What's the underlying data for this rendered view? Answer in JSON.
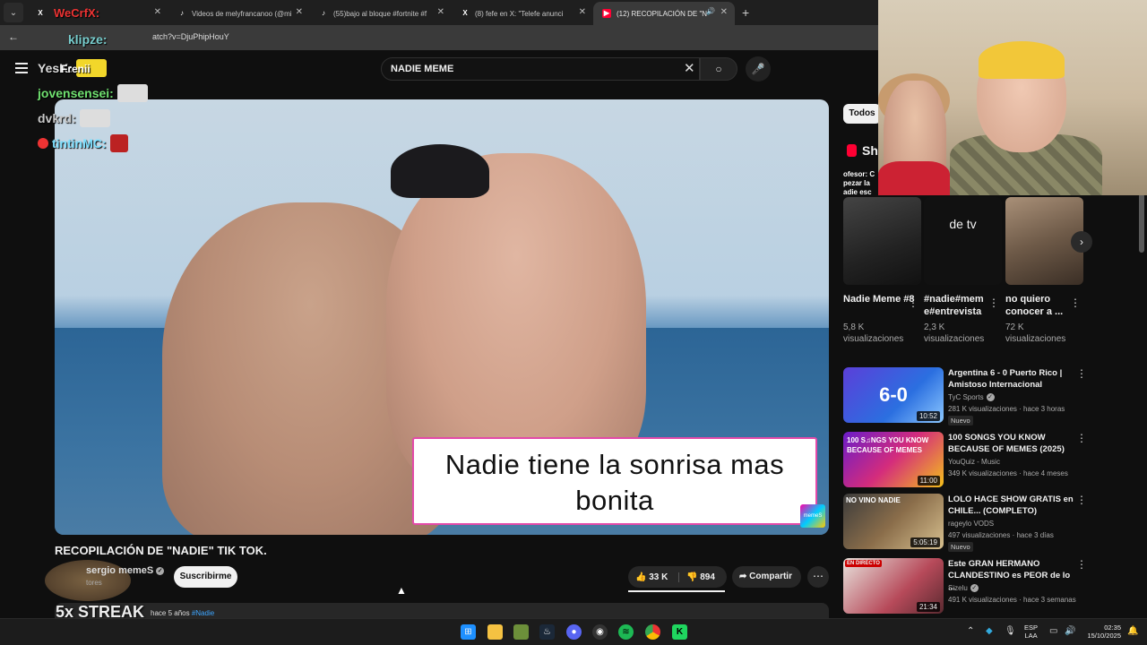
{
  "browser": {
    "tabs": [
      {
        "label": "",
        "icon": "x-logo-icon",
        "active": false
      },
      {
        "label": "Videos de melyfrancanoo (@mi",
        "icon": "tiktok-icon",
        "active": false
      },
      {
        "label": "(55)bajo al bloque #fortnite #f",
        "icon": "tiktok-icon",
        "active": false
      },
      {
        "label": "(8) fefe en X: \"Telefe anunci",
        "icon": "x-logo-icon",
        "active": false
      },
      {
        "label": "(12) RECOPILACIÓN DE \"N",
        "icon": "youtube-icon",
        "active": true
      }
    ],
    "url_partial": "atch?v=DjuPhipHouY"
  },
  "search": {
    "value": "NADIE MEME"
  },
  "video": {
    "caption": "Nadie tiene la sonrisa mas bonita",
    "title": "RECOPILACIÓN DE \"NADIE\" TIK TOK.",
    "channel": "sergio memeS",
    "subscribers_partial": "tores",
    "subscribe_label": "Suscribirme",
    "likes": "33 K",
    "dislikes": "894",
    "share_label": "Compartir",
    "description_meta": "hace 5 años",
    "description_tag": "#Nadie",
    "progress": 1.0
  },
  "overlay": {
    "chat": [
      {
        "user": "YesK:",
        "emote": "minion-emote"
      },
      {
        "user": "jovensensei:",
        "emote": "white-dog-emote"
      },
      {
        "user": "dvkrd:",
        "emote": "white-dog-emote"
      },
      {
        "user": "tintinMC:",
        "emote": "devil-emote"
      }
    ],
    "top_names": [
      "WeCrfX:",
      "klipze:",
      "Frenii"
    ],
    "streak": "5x STREAK"
  },
  "sidebar": {
    "chip": "Todos",
    "shorts_heading": "Sho",
    "shorts_snippet": "ofesor: C\npezar la\nadie esc",
    "shorts": [
      {
        "title": "Nadie Meme #8",
        "views": "5,8 K visualizaciones",
        "thumb_text": ""
      },
      {
        "title": "#nadie#mem e#entrevista",
        "views": "2,3 K visualizaciones",
        "thumb_text": "de tv"
      },
      {
        "title": "no quiero conocer a ...",
        "views": "72 K visualizaciones",
        "thumb_text": ""
      }
    ],
    "recommended": [
      {
        "title": "Argentina 6 - 0 Puerto Rico | Amistoso Internacional",
        "channel": "TyC Sports",
        "meta": "281 K visualizaciones · hace 3 horas",
        "duration": "10:52",
        "badge": "Nuevo",
        "thumb_text": "6-0",
        "verified": true,
        "live": false
      },
      {
        "title": "100 SONGS YOU KNOW BECAUSE OF MEMES (2025)",
        "channel": "YouQuiz - Music",
        "meta": "349 K visualizaciones · hace 4 meses",
        "duration": "11:00",
        "badge": "",
        "thumb_text": "100 S♫NGS YOU KNOW BECAUSE OF MEMES",
        "verified": false,
        "live": false
      },
      {
        "title": "LOLO HACE SHOW GRATIS en CHILE... (COMPLETO)",
        "channel": "rageylo VODS",
        "meta": "497 visualizaciones · hace 3 días",
        "duration": "5:05:19",
        "badge": "Nuevo",
        "thumb_text": "NO VINO NADIE",
        "verified": false,
        "live": false
      },
      {
        "title": "Este GRAN HERMANO CLANDESTINO es PEOR de lo ...",
        "channel": "Sizelu",
        "meta": "491 K visualizaciones · hace 3 semanas",
        "duration": "21:34",
        "badge": "",
        "thumb_text": "EN DIRECTO",
        "verified": true,
        "live": true
      }
    ]
  },
  "taskbar": {
    "lang": "ESP\nLAA",
    "time": "02:35",
    "date": "15/10/2025"
  },
  "colors": {
    "accent": "#ff0033",
    "caption_border": "#e34aa9",
    "link": "#3ea6ff"
  }
}
